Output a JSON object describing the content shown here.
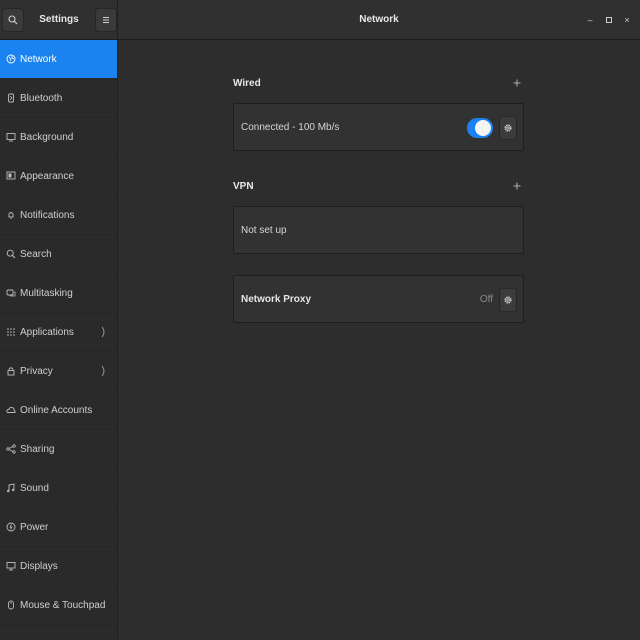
{
  "app": {
    "sidebar_title": "Settings",
    "panel_title": "Network"
  },
  "titlebar": {
    "search_icon": "search-icon",
    "menu_icon": "hamburger-menu-icon",
    "minimize_glyph": "–",
    "maximize_glyph": "▫",
    "close_glyph": "×"
  },
  "sidebar": {
    "items": [
      {
        "label": "Network",
        "icon": "network-icon",
        "active": true
      },
      {
        "label": "Bluetooth",
        "icon": "bluetooth-icon"
      },
      {
        "label": "Background",
        "icon": "background-icon"
      },
      {
        "label": "Appearance",
        "icon": "appearance-icon"
      },
      {
        "label": "Notifications",
        "icon": "bell-icon"
      },
      {
        "label": "Search",
        "icon": "search-icon"
      },
      {
        "label": "Multitasking",
        "icon": "multitasking-icon"
      },
      {
        "label": "Applications",
        "icon": "grid-icon",
        "chevron": true
      },
      {
        "label": "Privacy",
        "icon": "lock-icon",
        "chevron": true
      },
      {
        "label": "Online Accounts",
        "icon": "cloud-icon"
      },
      {
        "label": "Sharing",
        "icon": "share-icon"
      },
      {
        "label": "Sound",
        "icon": "music-note-icon"
      },
      {
        "label": "Power",
        "icon": "power-icon"
      },
      {
        "label": "Displays",
        "icon": "display-icon"
      },
      {
        "label": "Mouse & Touchpad",
        "icon": "mouse-icon"
      }
    ]
  },
  "wired": {
    "title": "Wired",
    "status": "Connected - 100 Mb/s",
    "toggle_on": true
  },
  "vpn": {
    "title": "VPN",
    "status": "Not set up"
  },
  "proxy": {
    "title": "Network Proxy",
    "state": "Off"
  },
  "colors": {
    "accent": "#1a83f0",
    "background": "#2d2d2d",
    "sidebar": "#2a2a2a",
    "card": "#323232"
  }
}
